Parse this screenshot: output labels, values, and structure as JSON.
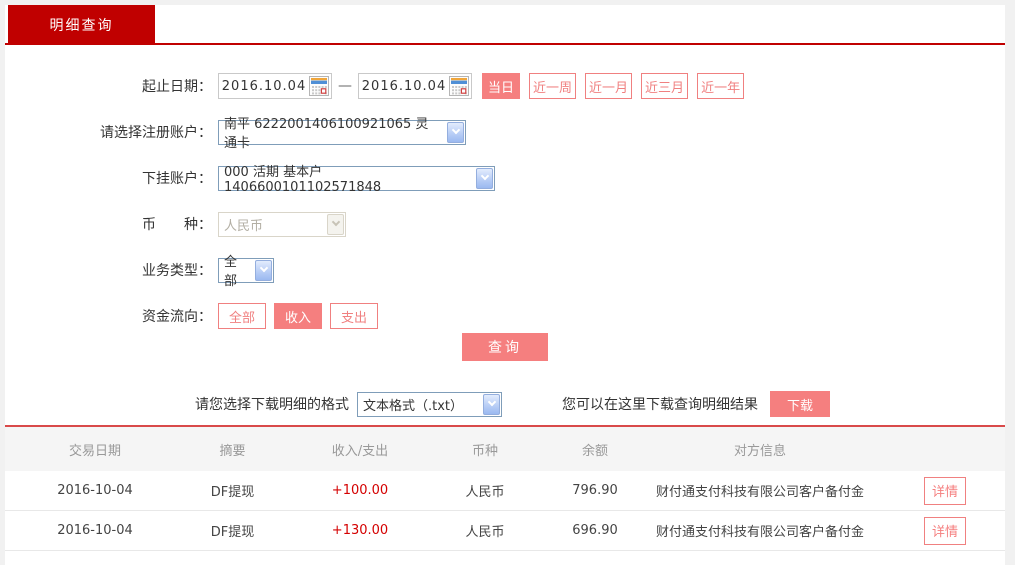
{
  "tab": {
    "label": "明细查询"
  },
  "form": {
    "date_range": {
      "label": "起止日期：",
      "start_value": "2016.10.04",
      "end_value": "2016.10.04",
      "separator": "—",
      "quick_buttons": [
        {
          "label": "当日",
          "active": true
        },
        {
          "label": "近一周",
          "active": false
        },
        {
          "label": "近一月",
          "active": false
        },
        {
          "label": "近三月",
          "active": false
        },
        {
          "label": "近一年",
          "active": false
        }
      ]
    },
    "registered_account": {
      "label": "请选择注册账户：",
      "value": "南平 6222001406100921065 灵通卡"
    },
    "sub_account": {
      "label": "下挂账户：",
      "value": "000 活期 基本户 1406600101102571848"
    },
    "currency": {
      "label": "币　　种：",
      "value": "人民币",
      "disabled": true
    },
    "business_type": {
      "label": "业务类型：",
      "value": "全部"
    },
    "fund_flow": {
      "label": "资金流向：",
      "options": [
        {
          "label": "全部",
          "active": false
        },
        {
          "label": "收入",
          "active": true
        },
        {
          "label": "支出",
          "active": false
        }
      ]
    },
    "query_button": "查询"
  },
  "download": {
    "format_label": "请您选择下载明细的格式",
    "format_value": "文本格式（.txt）",
    "hint": "您可以在这里下载查询明细结果",
    "button": "下载"
  },
  "table": {
    "headers": [
      "交易日期",
      "摘要",
      "收入/支出",
      "币种",
      "余额",
      "对方信息"
    ],
    "rows": [
      {
        "date": "2016-10-04",
        "summary": "DF提现",
        "amount": "+100.00",
        "currency": "人民币",
        "balance": "796.90",
        "counterparty": "财付通支付科技有限公司客户备付金",
        "detail_button": "详情"
      },
      {
        "date": "2016-10-04",
        "summary": "DF提现",
        "amount": "+130.00",
        "currency": "人民币",
        "balance": "696.90",
        "counterparty": "财付通支付科技有限公司客户备付金",
        "detail_button": "详情"
      }
    ]
  },
  "colors": {
    "brand_red": "#c00000",
    "accent_salmon": "#f57f7f",
    "amount_red": "#d40000"
  }
}
